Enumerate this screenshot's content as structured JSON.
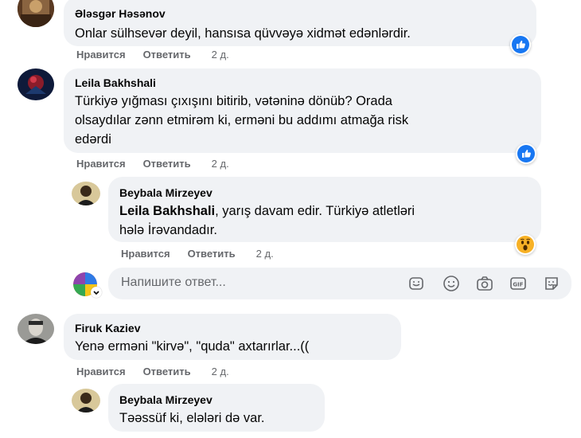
{
  "comments": [
    {
      "author": "Ələsgər Həsənov",
      "text": "Onlar sülhsevər deyil, hansısa qüvvəyə xidmət edənlərdir.",
      "actions": {
        "like": "Нравится",
        "reply": "Ответить",
        "time": "2 д."
      },
      "reaction": "like-icon"
    },
    {
      "author": "Leila Bakhshali",
      "text_lines": [
        "Türkiyə yığması çıxışını bitirib, vətəninə dönüb? Orada",
        "olsaydılar zənn etmirəm ki, erməni bu addımı atmağa risk",
        "edərdi"
      ],
      "actions": {
        "like": "Нравится",
        "reply": "Ответить",
        "time": "2 д."
      },
      "reaction": "like-icon",
      "reply": {
        "author": "Beybala Mirzeyev",
        "mention": "Leila Bakhshali",
        "text_line1": ", yarış davam edir. Türkiyə atletləri",
        "text_line2": "hələ İrəvandadır.",
        "actions": {
          "like": "Нравится",
          "reply": "Ответить",
          "time": "2 д."
        },
        "reaction": "wow-icon"
      }
    },
    {
      "author": "Firuk Kaziev",
      "text": "Yenə erməni \"kirvə\", \"quda\" axtarırlar...((",
      "actions": {
        "like": "Нравится",
        "reply": "Ответить",
        "time": "2 д."
      },
      "reply": {
        "author": "Beybala Mirzeyev",
        "text": "Təəssüf ki, elələri də var."
      }
    }
  ],
  "reply_box": {
    "placeholder": "Напишите ответ...",
    "tools": [
      "sticker-icon",
      "emoji-icon",
      "camera-icon",
      "gif-icon",
      "sticker-face-icon"
    ]
  },
  "colors": {
    "bubble": "#f0f2f5",
    "meta_text": "#65676b",
    "like_blue": "#1877f2",
    "wow_yellow": "#f7b125"
  }
}
